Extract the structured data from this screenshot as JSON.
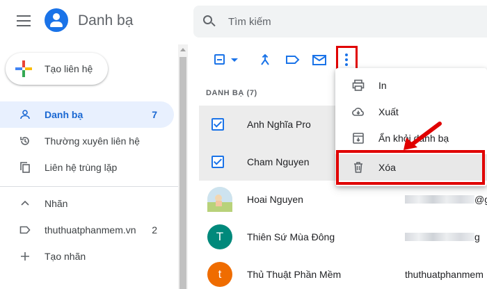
{
  "app": {
    "title": "Danh bạ",
    "search_placeholder": "Tìm kiếm"
  },
  "sidebar": {
    "create_label": "Tạo liên hệ",
    "items": [
      {
        "label": "Danh bạ",
        "count": "7",
        "icon": "person-icon",
        "active": true
      },
      {
        "label": "Thường xuyên liên hệ",
        "count": "",
        "icon": "history-icon"
      },
      {
        "label": "Liên hệ trùng lặp",
        "count": "",
        "icon": "copy-icon"
      }
    ],
    "labels_section": {
      "label": "Nhãn",
      "icon": "chevron-up-icon"
    },
    "labels": [
      {
        "label": "thuthuatphanmem.vn",
        "count": "2",
        "icon": "label-icon"
      }
    ],
    "create_label_item": {
      "label": "Tạo nhãn",
      "icon": "plus-icon"
    }
  },
  "toolbar": {
    "icons": [
      "select-all-icon",
      "merge-icon",
      "label-icon",
      "email-icon",
      "more-vert-icon"
    ]
  },
  "list": {
    "header": "DANH BẠ (7)",
    "rows": [
      {
        "name": "Anh Nghĩa Pro",
        "selected": true,
        "avatar": "",
        "email": ""
      },
      {
        "name": "Cham Nguyen",
        "selected": true,
        "avatar": "",
        "email": ""
      },
      {
        "name": "Hoai Nguyen",
        "selected": false,
        "avatar": "photo",
        "email_tail": "@g"
      },
      {
        "name": "Thiên Sứ Mùa Đông",
        "selected": false,
        "avatar": "T",
        "avatar_color": "#00897b",
        "email_tail": "g"
      },
      {
        "name": "Thủ Thuật Phần Mềm",
        "selected": false,
        "avatar": "t",
        "avatar_color": "#ef6c00",
        "email": "thuthuatphanmem"
      }
    ]
  },
  "menu": {
    "items": [
      {
        "label": "In",
        "icon": "print-icon"
      },
      {
        "label": "Xuất",
        "icon": "cloud-download-icon"
      },
      {
        "label": "Ẩn khỏi danh bạ",
        "icon": "archive-icon"
      },
      {
        "label": "Xóa",
        "icon": "trash-icon"
      }
    ]
  },
  "colors": {
    "accent": "#1a73e8",
    "highlight_box": "#e00000"
  }
}
